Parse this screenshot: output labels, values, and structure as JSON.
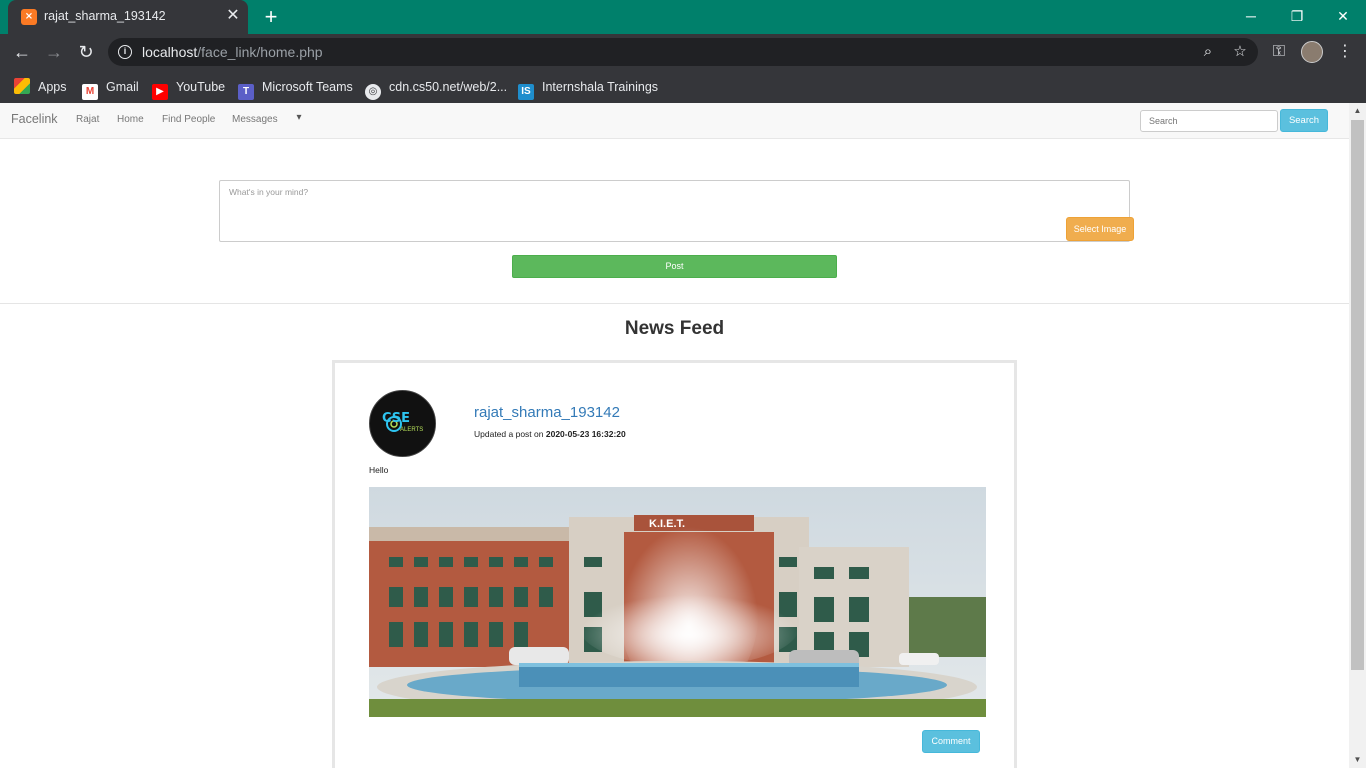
{
  "browser": {
    "tab_title": "rajat_sharma_193142",
    "tab_favicon": "XAMPP",
    "url_host": "localhost",
    "url_path": "/face_link/home.php",
    "bookmarks": [
      {
        "label": "Apps",
        "icon": "apps-grid-icon"
      },
      {
        "label": "Gmail",
        "icon": "gmail-icon"
      },
      {
        "label": "YouTube",
        "icon": "youtube-icon"
      },
      {
        "label": "Microsoft Teams",
        "icon": "teams-icon"
      },
      {
        "label": "cdn.cs50.net/web/2...",
        "icon": "globe-icon"
      },
      {
        "label": "Internshala Trainings",
        "icon": "internshala-icon"
      }
    ],
    "colors": {
      "titlebar": "#00806b",
      "tab": "#35363a"
    }
  },
  "navbar": {
    "brand": "Facelink",
    "links": [
      "Rajat",
      "Home",
      "Find People",
      "Messages"
    ],
    "search_placeholder": "Search",
    "search_button": "Search"
  },
  "composer": {
    "placeholder": "What's in your mind?",
    "select_image_label": "Select Image",
    "post_label": "Post"
  },
  "feed": {
    "title": "News Feed",
    "posts": [
      {
        "author": "rajat_sharma_193142",
        "action_text": "Updated a post on",
        "timestamp": "2020-05-23 16:32:20",
        "text": "Hello",
        "image_sign": "K.I.E.T.",
        "comment_label": "Comment",
        "avatar_text": "CSE",
        "avatar_subtext": "ALERTS"
      }
    ]
  }
}
